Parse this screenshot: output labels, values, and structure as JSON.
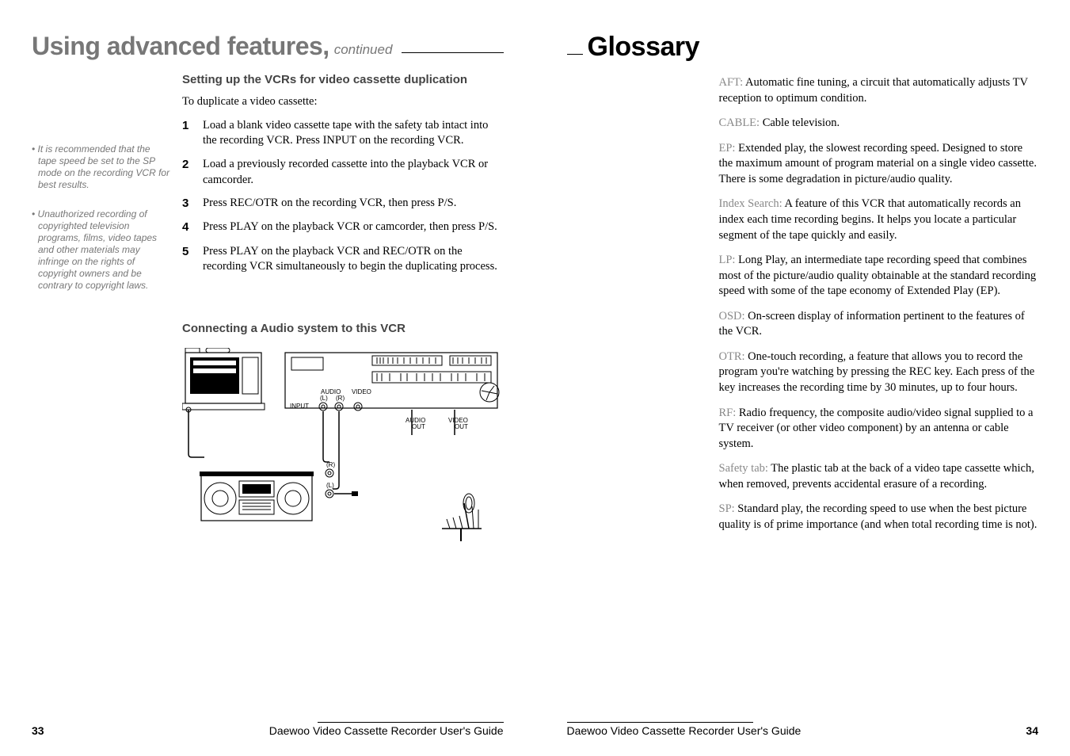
{
  "left": {
    "title_main": "Using advanced features,",
    "title_sub": "continued",
    "side_notes": [
      "• It is recommended that the tape speed be set to the SP mode on the recording VCR for best results.",
      "• Unauthorized recording of copyrighted television programs, films, video tapes and other materials may infringe on the rights of copyright owners and be contrary to copyright laws."
    ],
    "section1_heading": "Setting up the VCRs for video cassette duplication",
    "intro": "To duplicate a video cassette:",
    "steps": [
      "Load a blank video cassette tape with the safety tab intact into the recording VCR. Press INPUT on the recording VCR.",
      "Load a previously recorded cassette into the playback VCR or camcorder.",
      "Press REC/OTR on the recording VCR, then press P/S.",
      "Press PLAY on the playback VCR or camcorder, then press P/S.",
      "Press PLAY on the playback VCR and REC/OTR on the recording VCR simultaneously to begin the duplicating process."
    ],
    "section2_heading": "Connecting a Audio system to this VCR",
    "diagram_labels": {
      "audio": "AUDIO",
      "video": "VIDEO",
      "input": "INPUT",
      "l": "(L)",
      "r": "(R)",
      "audio_out": "AUDIO\nOUT",
      "video_out": "VIDEO\nOUT"
    },
    "footer": "Daewoo Video Cassette Recorder User's Guide",
    "page_num": "33"
  },
  "right": {
    "title": "Glossary",
    "entries": [
      {
        "term": "AFT:",
        "def": " Automatic fine tuning, a circuit that automatically adjusts TV reception to optimum condition."
      },
      {
        "term": "CABLE:",
        "def": " Cable television."
      },
      {
        "term": "EP:",
        "def": " Extended play, the slowest recording speed. Designed to store the maximum amount of program material on a single video cassette. There is some degradation in picture/audio quality."
      },
      {
        "term": "Index Search:",
        "def": " A feature of this VCR that automatically records an index each time recording begins. It helps you locate a particular segment of the tape quickly and easily."
      },
      {
        "term": "LP:",
        "def": " Long Play, an intermediate tape recording speed that combines most of the picture/audio quality obtainable at the standard recording speed with some of the tape economy of Extended Play (EP)."
      },
      {
        "term": "OSD:",
        "def": " On-screen display of information pertinent to the features of the VCR."
      },
      {
        "term": "OTR:",
        "def": " One-touch recording, a feature that allows you to record the program you're watching by pressing the REC key. Each press of the key increases the recording time by 30 minutes, up to four hours."
      },
      {
        "term": "RF:",
        "def": " Radio frequency, the composite audio/video signal supplied to a TV receiver (or other video component) by an antenna or cable system."
      },
      {
        "term": "Safety tab:",
        "def": " The plastic tab at the back of a video tape cassette which, when removed, prevents accidental erasure of a recording."
      },
      {
        "term": "SP:",
        "def": " Standard play, the recording speed to use when the best picture quality is of prime importance (and when total recording time is not)."
      }
    ],
    "footer": "Daewoo Video Cassette Recorder User's Guide",
    "page_num": "34"
  }
}
